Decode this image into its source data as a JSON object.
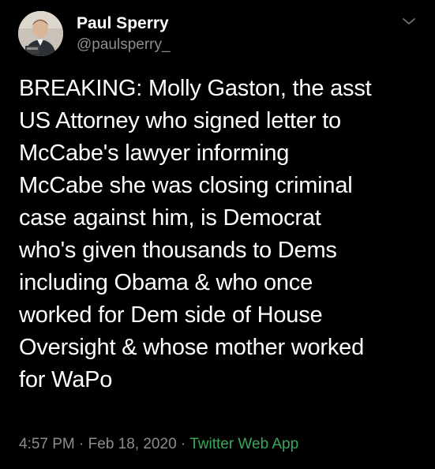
{
  "author": {
    "display_name": "Paul Sperry",
    "handle": "@paulsperry_",
    "avatar_icon": "person-avatar-icon"
  },
  "tweet": {
    "text": "BREAKING: Molly Gaston, the asst\nUS Attorney who signed letter to\nMcCabe's lawyer informing\nMcCabe she was closing criminal\ncase against him, is Democrat\nwho's given thousands to Dems\nincluding Obama & who once\nworked for Dem side of House\nOversight & whose mother worked\nfor WaPo"
  },
  "meta": {
    "time": "4:57 PM",
    "separator1": " · ",
    "date": "Feb 18, 2020",
    "separator2": " · ",
    "source": "Twitter Web App"
  },
  "colors": {
    "background": "#000000",
    "text": "#ffffff",
    "secondary": "#8a8d91",
    "source_link": "#3aa85c"
  },
  "icons": {
    "menu": "chevron-down-icon"
  }
}
